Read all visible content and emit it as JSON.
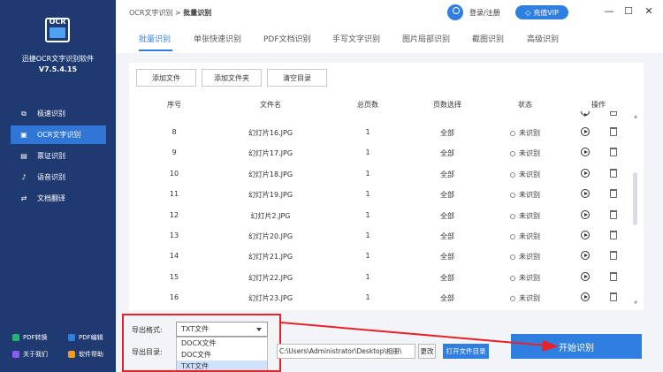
{
  "app": {
    "name": "迅捷OCR文字识别软件",
    "version": "V7.5.4.15",
    "logo_text": "OCR"
  },
  "breadcrumb": {
    "root": "OCR文字识别",
    "sep": ">",
    "current": "批量识别"
  },
  "header": {
    "login": "登录/注册",
    "vip": "充值VIP",
    "vip_icon": "diamond-icon"
  },
  "window": {
    "minimize": "—",
    "maximize": "☐",
    "close": "✕"
  },
  "sidebar": {
    "items": [
      {
        "label": "极速识别",
        "icon": "ocr-scan-icon"
      },
      {
        "label": "OCR文字识别",
        "icon": "text-scan-icon"
      },
      {
        "label": "票证识别",
        "icon": "ticket-icon"
      },
      {
        "label": "语音识别",
        "icon": "microphone-icon"
      },
      {
        "label": "文档翻译",
        "icon": "translate-icon"
      }
    ],
    "footer": [
      {
        "label": "PDF转换",
        "icon": "pdf-convert-icon",
        "color": "#21b573"
      },
      {
        "label": "PDF编辑",
        "icon": "pdf-edit-icon",
        "color": "#2f7fe0"
      },
      {
        "label": "关于我们",
        "icon": "about-icon",
        "color": "#8a5cf5"
      },
      {
        "label": "软件帮助",
        "icon": "help-icon",
        "color": "#f29b1d"
      }
    ]
  },
  "tabs": [
    "批量识别",
    "单张快速识别",
    "PDF文档识别",
    "手写文字识别",
    "图片局部识别",
    "截图识别",
    "高级识别"
  ],
  "toolbar": {
    "add_file": "添加文件",
    "add_folder": "添加文件夹",
    "clear": "清空目录"
  },
  "table": {
    "headers": [
      "序号",
      "文件名",
      "总页数",
      "页数选择",
      "状态",
      "操作"
    ],
    "rows": [
      {
        "no": "8",
        "name": "幻灯片16.JPG",
        "pages": "1",
        "range": "全部",
        "status": "未识别"
      },
      {
        "no": "9",
        "name": "幻灯片17.JPG",
        "pages": "1",
        "range": "全部",
        "status": "未识别"
      },
      {
        "no": "10",
        "name": "幻灯片18.JPG",
        "pages": "1",
        "range": "全部",
        "status": "未识别"
      },
      {
        "no": "11",
        "name": "幻灯片19.JPG",
        "pages": "1",
        "range": "全部",
        "status": "未识别"
      },
      {
        "no": "12",
        "name": "幻灯片2.JPG",
        "pages": "1",
        "range": "全部",
        "status": "未识别"
      },
      {
        "no": "13",
        "name": "幻灯片20.JPG",
        "pages": "1",
        "range": "全部",
        "status": "未识别"
      },
      {
        "no": "14",
        "name": "幻灯片21.JPG",
        "pages": "1",
        "range": "全部",
        "status": "未识别"
      },
      {
        "no": "15",
        "name": "幻灯片22.JPG",
        "pages": "1",
        "range": "全部",
        "status": "未识别"
      },
      {
        "no": "16",
        "name": "幻灯片23.JPG",
        "pages": "1",
        "range": "全部",
        "status": "未识别"
      }
    ]
  },
  "export": {
    "format_label": "导出格式:",
    "format_value": "TXT文件",
    "format_options": [
      "DOCX文件",
      "DOC文件",
      "TXT文件"
    ],
    "dir_label": "导出目录:",
    "dir_value": "C:\\Users\\Administrator\\Desktop\\相册\\",
    "change": "更改",
    "open_folder": "打开文件目录"
  },
  "start_button": "开始识别",
  "colors": {
    "sidebar": "#1f3a70",
    "accent": "#2f7fe0",
    "highlight": "#e8222b"
  }
}
